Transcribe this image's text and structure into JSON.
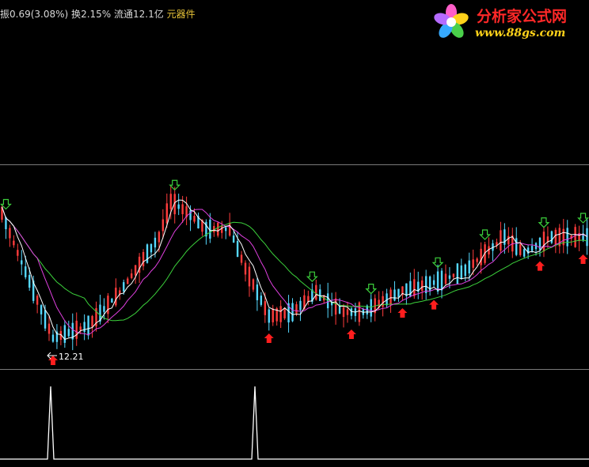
{
  "info_bar": {
    "change_label": "振",
    "change_value": "0.69(3.08%)",
    "turnover_label": "换",
    "turnover_value": "2.15%",
    "float_label": "流通",
    "float_value": "12.1亿",
    "stock_type": "元器件"
  },
  "logo": {
    "title": "分析家公式网",
    "url": "www.88gs.com"
  },
  "chart_data": {
    "type": "candlestick",
    "low_label": "12.21",
    "colors": {
      "up": "#ff3c3c",
      "down": "#55d8ff",
      "ma_short": "#ffffff",
      "ma_mid": "#e040e0",
      "ma_long": "#3cd23c",
      "buy_arrow": "#ff1e1e",
      "sell_arrow": "#3ccf3c",
      "indicator": "#ffffff"
    },
    "buy_signals": [
      13,
      68,
      89,
      102,
      110,
      137,
      148
    ],
    "sell_signals": [
      1,
      44,
      79,
      94,
      111,
      123,
      138,
      148
    ]
  }
}
